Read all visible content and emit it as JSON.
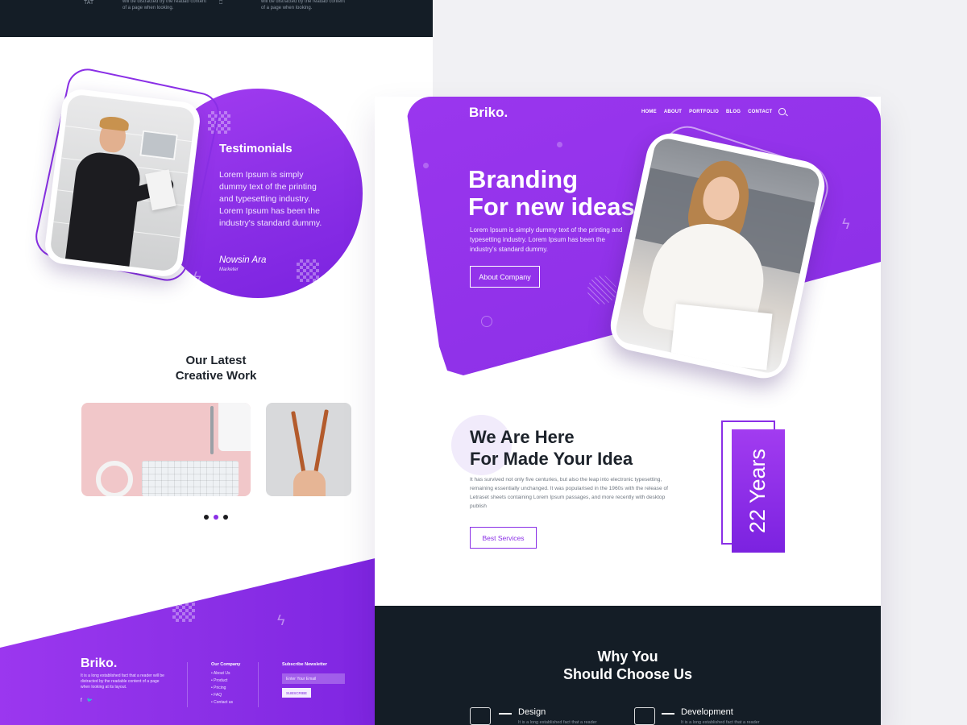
{
  "left_page": {
    "topbar": {
      "text_1": "will be distracted by the readab content of a page when looking.",
      "text_2": "will be distracted by the readab content of a page when looking.",
      "glyph_1": "TAT",
      "glyph_2": "⎕"
    },
    "testimonial": {
      "title": "Testimonials",
      "body": "Lorem Ipsum is simply dummy text of the printing and typesetting industry. Lorem Ipsum has been the industry's standard dummy.",
      "name": "Nowsin Ara",
      "role": "Marketer"
    },
    "latest_work": {
      "title_line1": "Our Latest",
      "title_line2": "Creative Work"
    },
    "carousel": {
      "active_index": 2,
      "count": 3
    },
    "footer": {
      "logo": "Briko.",
      "about_text": "It is a long established fact that a reader will be distracted by the readable content of a page when looking at its layout.",
      "social": "f  ὂ6",
      "company_title": "Our Company",
      "company_links": [
        "About Us",
        "Product",
        "Pricing",
        "FAQ",
        "Contact us"
      ],
      "newsletter_title": "Subscribe Newsletter",
      "newsletter_placeholder": "Enter Your Email",
      "subscribe_label": "SUBSCRIBE"
    }
  },
  "right_page": {
    "brand": "Briko.",
    "nav": [
      "HOME",
      "ABOUT",
      "PORTFOLIO",
      "BLOG",
      "CONTACT"
    ],
    "hero": {
      "title_line1": "Branding",
      "title_line2": "For new ideas",
      "description": "Lorem Ipsum is simply dummy text of the printing and typesetting industry. Lorem Ipsum has been the industry's standard dummy.",
      "button_label": "About Company"
    },
    "about": {
      "title_line1": "We Are Here",
      "title_line2": "For Made Your Idea",
      "body": "It has survived not only five centuries, but also the leap into electronic typesetting, remaining essentially unchanged. It was popularised in the 1960s with the release of Letraset sheets containing Lorem Ipsum passages, and more recently with desktop publish",
      "button_label": "Best Services",
      "years_label": "22 Years"
    },
    "why": {
      "title_line1": "Why You",
      "title_line2": "Should Choose Us",
      "features": [
        {
          "title": "Design",
          "desc": "It is a long established fact that a reader"
        },
        {
          "title": "Development",
          "desc": "It is a long established fact that a reader"
        }
      ]
    }
  },
  "colors": {
    "accent": "#8a2fe6",
    "accent_dark": "#7b22e0",
    "dark_band": "#141d26",
    "heading": "#1d232b"
  }
}
